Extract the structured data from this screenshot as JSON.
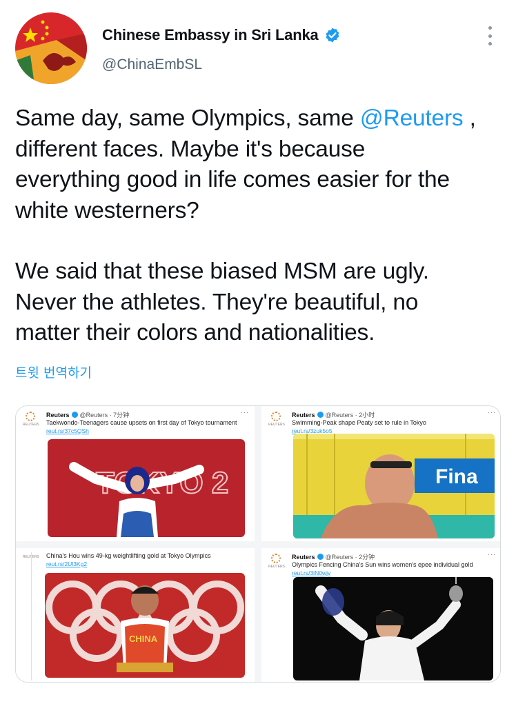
{
  "account": {
    "display_name": "Chinese Embassy in Sri Lanka",
    "handle": "@ChinaEmbSL",
    "verified": true,
    "avatar_icon": "china-srilanka-flag-avatar"
  },
  "tweet": {
    "line1_before": "Same day, same Olympics, same ",
    "mention": "@Reuters",
    "line1_after": " ,\ndifferent faces. Maybe it's because\neverything good in life comes easier for the\nwhite westerners?",
    "paragraph2": "We said that these biased MSM are ugly.\nNever the athletes. They're beautiful, no\nmatter their colors and nationalities.",
    "translate_label": "트윗 번역하기"
  },
  "colors": {
    "accent": "#1d9bf0",
    "text": "#0f1419",
    "secondary": "#536471"
  },
  "media": [
    {
      "source": "Reuters",
      "meta": "@Reuters · 7分钟",
      "headline": "Taekwondo-Teenagers cause upsets on first day of Tokyo tournament",
      "link": "reut.rs/37c5QSh",
      "photo_text": "TOKYO 2"
    },
    {
      "source": "Reuters",
      "meta": "@Reuters · 2小时",
      "headline": "Swimming-Peak shape Peaty set to rule in Tokyo",
      "link": "reut.rs/3zuk5o5",
      "photo_text": "Fina"
    },
    {
      "source": "",
      "meta": "",
      "headline": "China's Hou wins 49-kg weightlifting gold at Tokyo Olympics",
      "link": "reut.rs/2Ul3Kg2",
      "photo_text": "CHINA"
    },
    {
      "source": "Reuters",
      "meta": "@Reuters · 2分钟",
      "headline": "Olympics Fencing China's Sun wins women's epee individual gold",
      "link": "reut.rs/3iN0wjv",
      "photo_text": ""
    }
  ],
  "logo_caption": "REUTERS"
}
